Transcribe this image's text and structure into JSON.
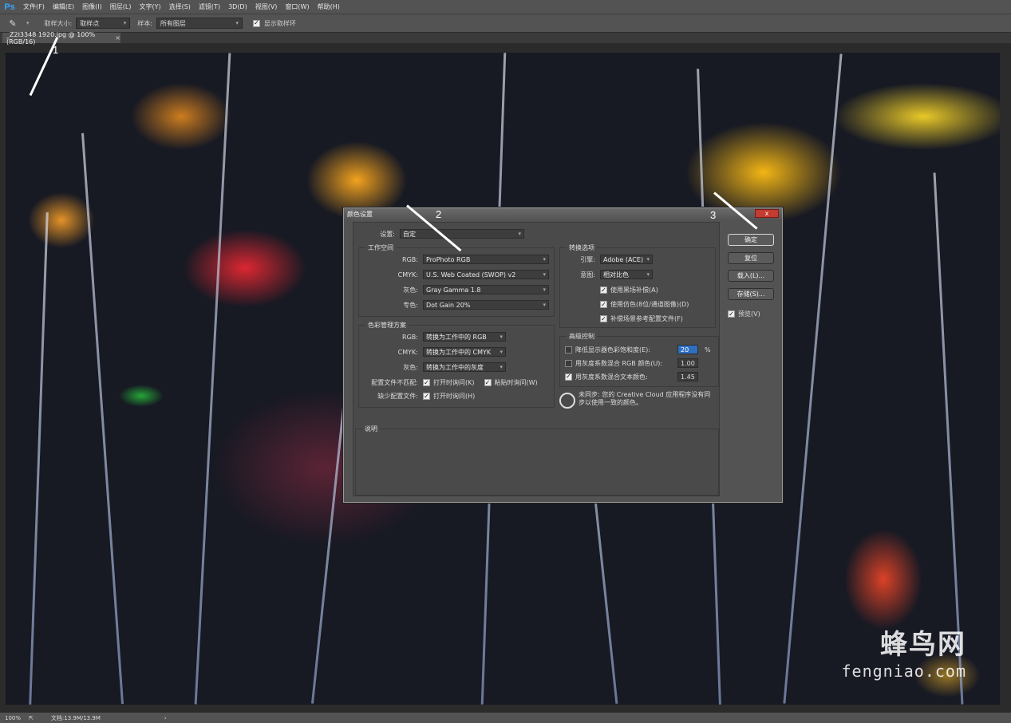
{
  "app": {
    "logo": "Ps"
  },
  "menu": [
    "文件(F)",
    "编辑(E)",
    "图像(I)",
    "图层(L)",
    "文字(Y)",
    "选择(S)",
    "滤镜(T)",
    "3D(D)",
    "视图(V)",
    "窗口(W)",
    "帮助(H)"
  ],
  "options_bar": {
    "sample_size_label": "取样大小:",
    "sample_size_value": "取样点",
    "sample_label": "样本:",
    "sample_value": "所有图层",
    "show_ring_label": "显示取样环"
  },
  "document_tab": {
    "title": "_Z2I3348 1920.jpg @ 100%(RGB/16)",
    "close": "×"
  },
  "status": {
    "zoom": "100%",
    "doc_info": "文档:13.9M/13.9M",
    "arrow": "›"
  },
  "watermark": {
    "cn": "蜂鸟网",
    "en": "fengniao.com"
  },
  "annotations": {
    "n1": "1",
    "n2": "2",
    "n3": "3"
  },
  "dialog": {
    "title": "颜色设置",
    "close": "x",
    "settings_label": "设置:",
    "settings_value": "自定",
    "working_spaces": {
      "title": "工作空间",
      "rows": [
        {
          "label": "RGB:",
          "value": "ProPhoto RGB"
        },
        {
          "label": "CMYK:",
          "value": "U.S. Web Coated (SWOP) v2"
        },
        {
          "label": "灰色:",
          "value": "Gray Gamma 1.8"
        },
        {
          "label": "专色:",
          "value": "Dot Gain 20%"
        }
      ]
    },
    "policies": {
      "title": "色彩管理方案",
      "rows": [
        {
          "label": "RGB:",
          "value": "转换为工作中的 RGB"
        },
        {
          "label": "CMYK:",
          "value": "转换为工作中的 CMYK"
        },
        {
          "label": "灰色:",
          "value": "转换为工作中的灰度"
        }
      ],
      "mismatch_label": "配置文件不匹配:",
      "mismatch_open": "打开时询问(K)",
      "mismatch_paste": "粘贴时询问(W)",
      "missing_label": "缺少配置文件:",
      "missing_open": "打开时询问(H)"
    },
    "conversion": {
      "title": "转换选项",
      "engine_label": "引擎:",
      "engine_value": "Adobe (ACE)",
      "intent_label": "意图:",
      "intent_value": "相对比色",
      "bpc": "使用黑场补偿(A)",
      "dither": "使用仿色(8位/通道图像)(D)",
      "compensate": "补偿场景参考配置文件(F)"
    },
    "advanced": {
      "title": "高级控制",
      "desaturate": "降低显示器色彩饱和度(E):",
      "desaturate_value": "20",
      "desaturate_unit": "%",
      "blend_rgb": "用灰度系数混合 RGB 颜色(U):",
      "blend_rgb_value": "1.00",
      "blend_text": "用灰度系数混合文本颜色:",
      "blend_text_value": "1.45"
    },
    "sync_note": "未同步: 您的 Creative Cloud 应用程序没有同步以使用一致的颜色。",
    "description_title": "说明",
    "buttons": {
      "ok": "确定",
      "reset": "复位",
      "load": "载入(L)...",
      "save": "存储(S)...",
      "preview": "预览(V)"
    }
  }
}
